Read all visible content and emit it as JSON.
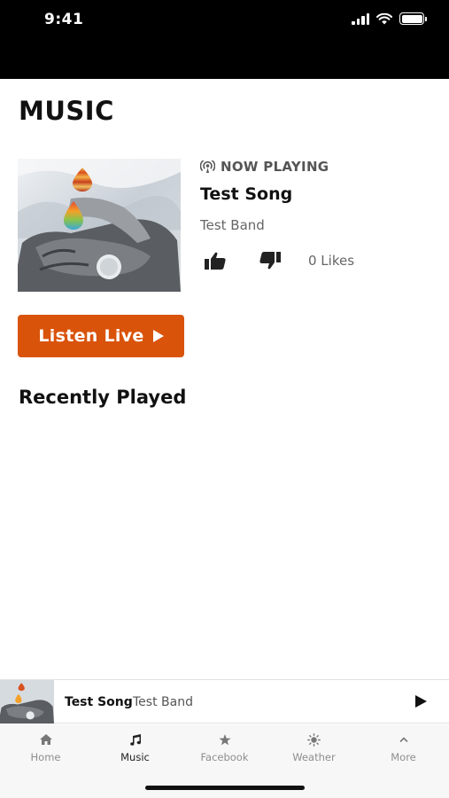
{
  "status_bar": {
    "time": "9:41"
  },
  "page": {
    "title": "MUSIC"
  },
  "now_playing": {
    "label": "NOW PLAYING",
    "song": "Test Song",
    "band": "Test Band",
    "likes": "0 Likes",
    "listen_label": "Listen Live"
  },
  "recently_played": {
    "title": "Recently Played"
  },
  "mini_player": {
    "song": "Test Song",
    "band": "Test Band"
  },
  "tabs": [
    {
      "label": "Home",
      "icon": "home-icon",
      "active": false
    },
    {
      "label": "Music",
      "icon": "music-note-icon",
      "active": true
    },
    {
      "label": "Facebook",
      "icon": "star-icon",
      "active": false
    },
    {
      "label": "Weather",
      "icon": "sun-icon",
      "active": false
    },
    {
      "label": "More",
      "icon": "chevron-up-icon",
      "active": false
    }
  ],
  "colors": {
    "accent": "#d9530b",
    "status_bar": "#000000",
    "tab_active": "#222222",
    "tab_inactive": "#8e8e8e"
  }
}
